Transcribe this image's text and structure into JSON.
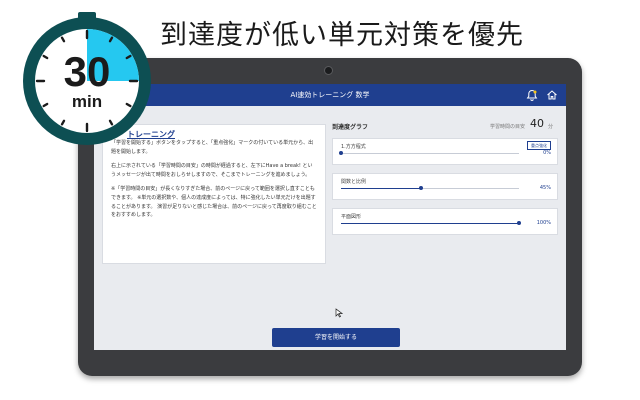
{
  "headline": "到達度が低い単元対策を優先",
  "timer": {
    "value": "30",
    "unit": "min",
    "elapsed_fraction": 0.25
  },
  "app": {
    "title": "AI速効トレーニング 数学",
    "icons": [
      "bell-icon",
      "home-icon"
    ]
  },
  "instructions": {
    "title": "トレーニング",
    "paragraphs": [
      "「学習を開始する」ボタンをタップすると、「重点強化」マークの付いている単元から、出題を開始します。",
      "右上に示されている「学習時間の目安」の時間が経過すると、左下にHave a break! というメッセージが出て時間をおしらせしますので、そこまでトレーニングを進めましょう。",
      "※「学習時間の目安」が長くなりすぎた場合、前のページに戻って範囲を選択し直すこともできます。 ※単元の選択数や、個人の達成度によっては、特に強化したい単元だけを出題することがあります。 演習が足りないと感じた場合は、前のページに戻って再度取り組むことをおすすめします。"
    ]
  },
  "progress": {
    "title": "到達度グラフ",
    "time_label": "学習時間の目安",
    "time_value": "40",
    "time_unit": "分",
    "units": [
      {
        "name": "1.方方程式",
        "badge": "重点強化",
        "percent": 0,
        "percent_label": "0%"
      },
      {
        "name": "関数と比例",
        "badge": "",
        "percent": 45,
        "percent_label": "45%"
      },
      {
        "name": "平面図形",
        "badge": "",
        "percent": 100,
        "percent_label": "100%"
      }
    ]
  },
  "start_button": "学習を開始する",
  "colors": {
    "accent": "#1f3f8f",
    "timer_ring": "#0d4f53",
    "timer_face": "#25c8f0"
  }
}
